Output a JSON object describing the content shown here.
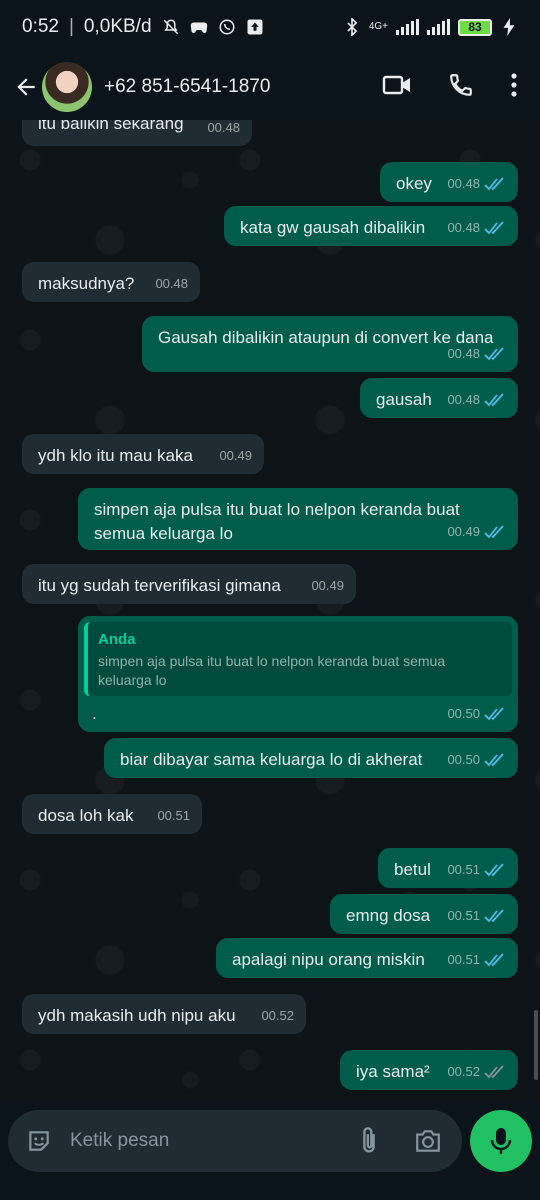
{
  "status_bar": {
    "time": "0:52",
    "speed": "0,0KB/d",
    "battery": "83",
    "network": "4G+"
  },
  "header": {
    "contact_name": "+62 851-6541-1870"
  },
  "messages": [
    {
      "dir": "in",
      "text": "itu balikin sekarang",
      "time": "00.48"
    },
    {
      "dir": "out",
      "text": "okey",
      "time": "00.48"
    },
    {
      "dir": "out",
      "text": "kata gw gausah dibalikin",
      "time": "00.48"
    },
    {
      "dir": "in",
      "text": "maksudnya?",
      "time": "00.48"
    },
    {
      "dir": "out",
      "text": "Gausah dibalikin ataupun di convert ke dana",
      "time": "00.48"
    },
    {
      "dir": "out",
      "text": "gausah",
      "time": "00.48"
    },
    {
      "dir": "in",
      "text": "ydh klo itu mau kaka",
      "time": "00.49"
    },
    {
      "dir": "out",
      "text": "simpen aja pulsa itu buat lo nelpon keranda buat semua keluarga lo",
      "time": "00.49"
    },
    {
      "dir": "in",
      "text": "itu yg sudah terverifikasi gimana",
      "time": "00.49"
    },
    {
      "dir": "out",
      "quote_author": "Anda",
      "quote_text": "simpen aja pulsa itu buat lo nelpon keranda buat semua keluarga lo",
      "text": ".",
      "time": "00.50"
    },
    {
      "dir": "out",
      "text": "biar dibayar sama keluarga lo di akherat",
      "time": "00.50"
    },
    {
      "dir": "in",
      "text": "dosa loh kak",
      "time": "00.51"
    },
    {
      "dir": "out",
      "text": "betul",
      "time": "00.51"
    },
    {
      "dir": "out",
      "text": "emng dosa",
      "time": "00.51"
    },
    {
      "dir": "out",
      "text": "apalagi nipu orang miskin",
      "time": "00.51"
    },
    {
      "dir": "in",
      "text": "ydh makasih udh nipu aku",
      "time": "00.52"
    },
    {
      "dir": "out",
      "text": "iya sama²",
      "time": "00.52",
      "read": false
    }
  ],
  "composer": {
    "placeholder": "Ketik pesan"
  },
  "colors": {
    "incoming": "#202c33",
    "outgoing": "#005c4b",
    "read_ticks": "#53bdeb",
    "unread_ticks": "#8696a0",
    "mic": "#21c063"
  }
}
